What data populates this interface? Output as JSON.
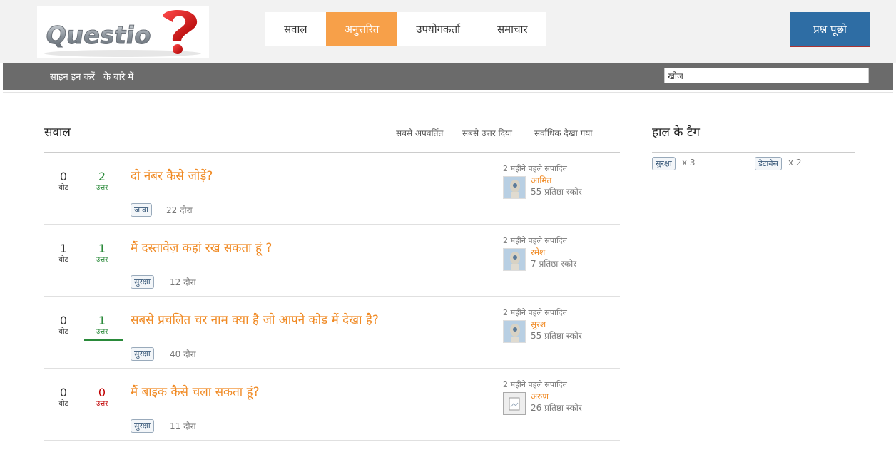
{
  "header": {
    "nav": [
      {
        "label": "सवाल",
        "active": false
      },
      {
        "label": "अनुत्तरित",
        "active": true
      },
      {
        "label": "उपयोगकर्ता",
        "active": false
      },
      {
        "label": "समाचार",
        "active": false
      }
    ],
    "ask_button": "प्रश्न पूछो",
    "logo_text": "Question?"
  },
  "subbar": {
    "signin": "साइन इन करें",
    "about": "के बारे में",
    "search_value": "खोज"
  },
  "main": {
    "title": "सवाल",
    "sort_options": [
      "सबसे अपवर्तित",
      "सबसे उत्तर दिया",
      "सर्वाधिक देखा गया"
    ],
    "questions": [
      {
        "votes": "0",
        "votes_label": "वोट",
        "answers": "2",
        "answers_label": "उत्तर",
        "title": "दो नंबर कैसे जोड़ें?",
        "tag": "जावा",
        "views": "22 दौरा",
        "edited": "2 महीने पहले संपादित",
        "user": "आमित",
        "rep": "55 प्रतिष्ठा स्कोर"
      },
      {
        "votes": "1",
        "votes_label": "वोट",
        "answers": "1",
        "answers_label": "उत्तर",
        "title": "मैं दस्तावेज़ कहां रख सकता हूं ?",
        "tag": "सुरक्षा",
        "views": "12 दौरा",
        "edited": "2 महीने पहले संपादित",
        "user": "रमेश",
        "rep": "7 प्रतिष्ठा स्कोर"
      },
      {
        "votes": "0",
        "votes_label": "वोट",
        "answers": "1",
        "answers_label": "उत्तर",
        "title": "सबसे प्रचलित चर नाम क्या है जो आपने कोड में देखा है?",
        "tag": "सुरक्षा",
        "views": "40 दौरा",
        "edited": "2 महीने पहले संपादित",
        "user": "सुरश",
        "rep": "55 प्रतिष्ठा स्कोर"
      },
      {
        "votes": "0",
        "votes_label": "वोट",
        "answers": "0",
        "answers_label": "उत्तर",
        "title": "मैं बाइक कैसे चला सकता हूं?",
        "tag": "सुरक्षा",
        "views": "11 दौरा",
        "edited": "2 महीने पहले संपादित",
        "user": "अरुण",
        "rep": "26 प्रतिष्ठा स्कोर"
      }
    ]
  },
  "sidebar": {
    "title": "हाल के टैग",
    "tags": [
      {
        "name": "सुरक्षा",
        "count": "x 3"
      },
      {
        "name": "डेटाबेस",
        "count": "x 2"
      }
    ]
  },
  "colors": {
    "accent_orange": "#f7a049",
    "link_orange": "#f08a24",
    "ask_blue": "#2e6da4",
    "answer_green": "#2a8a3a",
    "answer_red": "#c00000",
    "subbar_gray": "#6b6b6b"
  }
}
